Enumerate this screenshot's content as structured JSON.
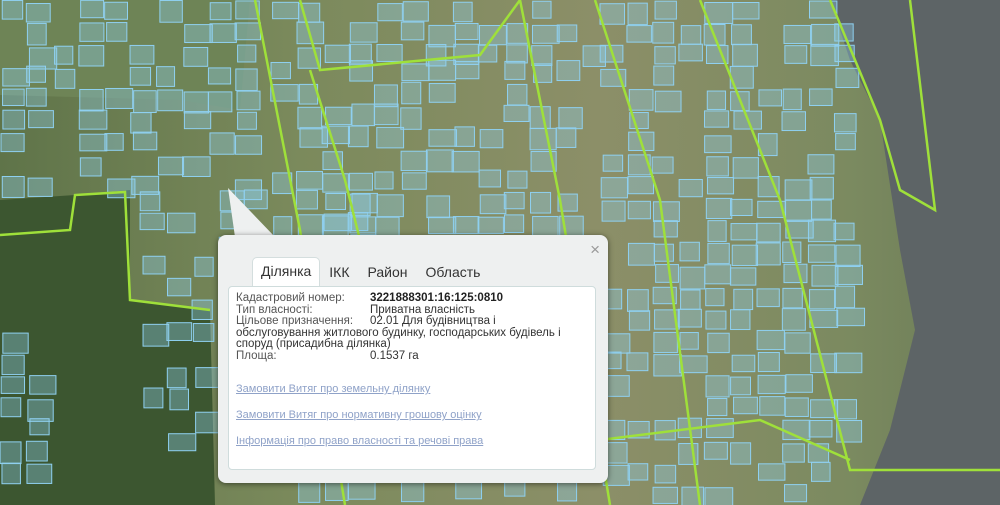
{
  "map": {
    "colors": {
      "parcel": "#8fd0f0",
      "boundary": "#9fe03a",
      "river": "#5d6466",
      "forest": "#3f5a32",
      "village": "#7f8a5e"
    }
  },
  "popup": {
    "close_icon": "×",
    "tabs": [
      {
        "label": "Ділянка",
        "active": true
      },
      {
        "label": "ІКК",
        "active": false
      },
      {
        "label": "Район",
        "active": false
      },
      {
        "label": "Область",
        "active": false
      }
    ],
    "fields": {
      "cadastral_label": "Кадастровий номер:",
      "cadastral_value": "3221888301:16:125:0810",
      "ownership_label": "Тип власності:",
      "ownership_value": "Приватна власність",
      "purpose_label": "Цільове призначення:",
      "purpose_value_first": "02.01 Для будівництва і",
      "purpose_value_rest": "обслуговування житлового будинку, господарських будівель і споруд (присадибна ділянка)",
      "area_label": "Площа:",
      "area_value": "0.1537 га"
    },
    "links": [
      "Замовити Витяг про земельну ділянку",
      "Замовити Витяг про нормативну грошову оцінку",
      "Інформація про право власності та речові права"
    ]
  }
}
